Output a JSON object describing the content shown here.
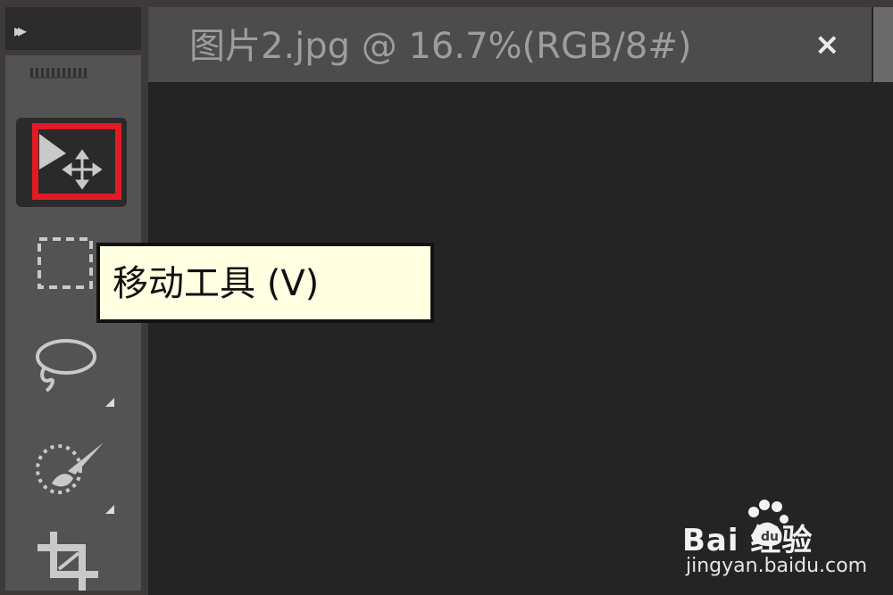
{
  "toolbar": {
    "collapse_glyph": "▸▸",
    "tools": [
      {
        "name": "move-tool",
        "icon": "move-icon",
        "selected": true
      },
      {
        "name": "rectangular-marquee-tool",
        "icon": "marquee-rectangle-icon",
        "selected": false
      },
      {
        "name": "lasso-tool",
        "icon": "lasso-icon",
        "selected": false
      },
      {
        "name": "quick-selection-tool",
        "icon": "quick-selection-brush-icon",
        "selected": false
      },
      {
        "name": "crop-tool",
        "icon": "crop-icon",
        "selected": false
      }
    ]
  },
  "document": {
    "tab_title": "图片2.jpg @ 16.7%(RGB/8#)",
    "close_glyph": "×"
  },
  "tooltip": {
    "text": "移动工具 (V)"
  },
  "watermark": {
    "brand": "Bai  经验",
    "url": "jingyan.baidu.com"
  },
  "colors": {
    "highlight": "#e21a24",
    "tooltip_bg": "#ffffe1",
    "panel_bg": "#535353",
    "canvas_bg": "#242424"
  }
}
